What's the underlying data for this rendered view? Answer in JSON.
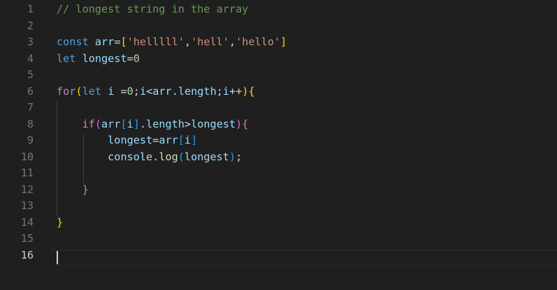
{
  "editor": {
    "line_numbers": [
      "1",
      "2",
      "3",
      "4",
      "5",
      "6",
      "7",
      "8",
      "9",
      "10",
      "11",
      "12",
      "13",
      "14",
      "15",
      "16"
    ],
    "current_line": "16",
    "colors": {
      "background": "#1f1f1f",
      "comment": "#6a9955",
      "keyword": "#569cd6",
      "control": "#c586c0",
      "variable": "#9cdcfe",
      "string": "#ce9178",
      "number": "#b5cea8",
      "bracket_level1": "#ffd700",
      "bracket_level2": "#da70d6",
      "bracket_level3": "#179fff"
    },
    "lines": [
      [
        {
          "t": "comment",
          "v": "// longest string in the array"
        }
      ],
      [],
      [
        {
          "t": "keyword",
          "v": "const"
        },
        {
          "t": "punct",
          "v": " "
        },
        {
          "t": "var",
          "v": "arr"
        },
        {
          "t": "punct",
          "v": "="
        },
        {
          "t": "b1",
          "v": "["
        },
        {
          "t": "string",
          "v": "'helllll'"
        },
        {
          "t": "punct",
          "v": ","
        },
        {
          "t": "string",
          "v": "'hell'"
        },
        {
          "t": "punct",
          "v": ","
        },
        {
          "t": "string",
          "v": "'hello'"
        },
        {
          "t": "b1",
          "v": "]"
        }
      ],
      [
        {
          "t": "keyword",
          "v": "let"
        },
        {
          "t": "punct",
          "v": " "
        },
        {
          "t": "var",
          "v": "longest"
        },
        {
          "t": "punct",
          "v": "="
        },
        {
          "t": "number",
          "v": "0"
        }
      ],
      [],
      [
        {
          "t": "control",
          "v": "for"
        },
        {
          "t": "b1",
          "v": "("
        },
        {
          "t": "keyword",
          "v": "let"
        },
        {
          "t": "punct",
          "v": " "
        },
        {
          "t": "var",
          "v": "i"
        },
        {
          "t": "punct",
          "v": " ="
        },
        {
          "t": "number",
          "v": "0"
        },
        {
          "t": "punct",
          "v": ";"
        },
        {
          "t": "var",
          "v": "i"
        },
        {
          "t": "punct",
          "v": "<"
        },
        {
          "t": "var",
          "v": "arr"
        },
        {
          "t": "punct",
          "v": "."
        },
        {
          "t": "var",
          "v": "length"
        },
        {
          "t": "punct",
          "v": ";"
        },
        {
          "t": "var",
          "v": "i"
        },
        {
          "t": "punct",
          "v": "++"
        },
        {
          "t": "b1",
          "v": ")"
        },
        {
          "t": "b1",
          "v": "{"
        }
      ],
      [],
      [
        {
          "t": "punct",
          "v": "    "
        },
        {
          "t": "control",
          "v": "if"
        },
        {
          "t": "b2",
          "v": "("
        },
        {
          "t": "var",
          "v": "arr"
        },
        {
          "t": "b3",
          "v": "["
        },
        {
          "t": "var",
          "v": "i"
        },
        {
          "t": "b3",
          "v": "]"
        },
        {
          "t": "punct",
          "v": "."
        },
        {
          "t": "var",
          "v": "length"
        },
        {
          "t": "punct",
          "v": ">"
        },
        {
          "t": "var",
          "v": "longest"
        },
        {
          "t": "b2",
          "v": ")"
        },
        {
          "t": "b2",
          "v": "{"
        }
      ],
      [
        {
          "t": "punct",
          "v": "        "
        },
        {
          "t": "var",
          "v": "longest"
        },
        {
          "t": "punct",
          "v": "="
        },
        {
          "t": "var",
          "v": "arr"
        },
        {
          "t": "b3",
          "v": "["
        },
        {
          "t": "var",
          "v": "i"
        },
        {
          "t": "b3",
          "v": "]"
        }
      ],
      [
        {
          "t": "punct",
          "v": "        "
        },
        {
          "t": "var",
          "v": "console"
        },
        {
          "t": "punct",
          "v": "."
        },
        {
          "t": "func",
          "v": "log"
        },
        {
          "t": "b3",
          "v": "("
        },
        {
          "t": "var",
          "v": "longest"
        },
        {
          "t": "b3",
          "v": ")"
        },
        {
          "t": "punct",
          "v": ";"
        }
      ],
      [],
      [
        {
          "t": "punct",
          "v": "    "
        },
        {
          "t": "b2",
          "v": "}"
        }
      ],
      [],
      [
        {
          "t": "b1",
          "v": "}"
        }
      ],
      [],
      []
    ]
  }
}
